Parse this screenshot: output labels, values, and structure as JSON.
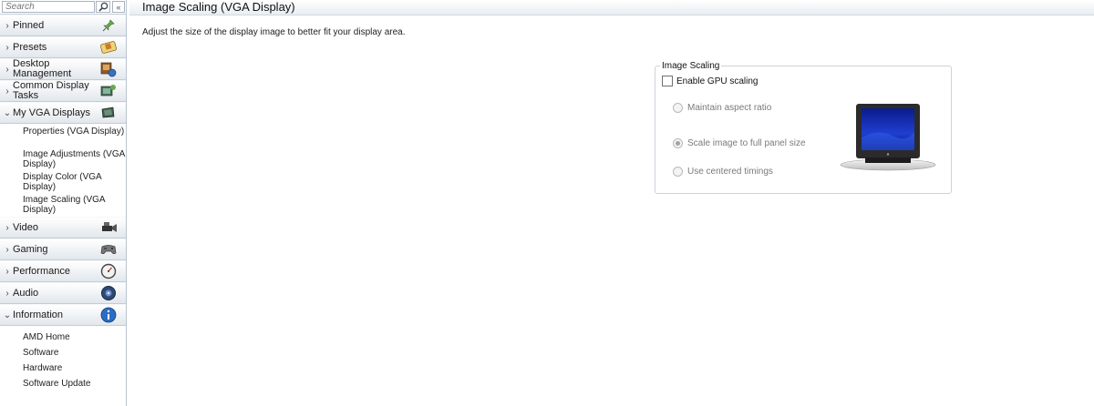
{
  "sidebar": {
    "search_placeholder": "Search",
    "collapse_label": "«",
    "categories": [
      {
        "label": "Pinned",
        "chevron": "›",
        "icon": "pin-icon"
      },
      {
        "label": "Presets",
        "chevron": "›",
        "icon": "presets-icon"
      },
      {
        "label": "Desktop Management",
        "chevron": "›",
        "icon": "desktop-management-icon"
      },
      {
        "label": "Common Display Tasks",
        "chevron": "›",
        "icon": "display-tasks-icon"
      },
      {
        "label": "My VGA Displays",
        "chevron": "⌄",
        "icon": "vga-display-icon"
      },
      {
        "label": "Video",
        "chevron": "›",
        "icon": "video-camera-icon"
      },
      {
        "label": "Gaming",
        "chevron": "›",
        "icon": "gamepad-icon"
      },
      {
        "label": "Performance",
        "chevron": "›",
        "icon": "gauge-icon"
      },
      {
        "label": "Audio",
        "chevron": "›",
        "icon": "speaker-icon"
      },
      {
        "label": "Information",
        "chevron": "⌄",
        "icon": "info-icon"
      }
    ],
    "vga_items": [
      "Properties (VGA Display)",
      "Image Adjustments (VGA Display)",
      "Display Color (VGA Display)",
      "Image Scaling (VGA Display)"
    ],
    "info_items": [
      "AMD Home",
      "Software",
      "Hardware",
      "Software Update"
    ]
  },
  "main": {
    "title": "Image Scaling (VGA Display)",
    "description": "Adjust the size of the display image to better fit your display area.",
    "group": {
      "legend": "Image Scaling",
      "enable_label": "Enable GPU scaling",
      "enable_checked": false,
      "options": [
        {
          "label": "Maintain aspect ratio",
          "selected": false
        },
        {
          "label": "Scale image to full panel size",
          "selected": true
        },
        {
          "label": "Use centered timings",
          "selected": false
        }
      ]
    }
  }
}
